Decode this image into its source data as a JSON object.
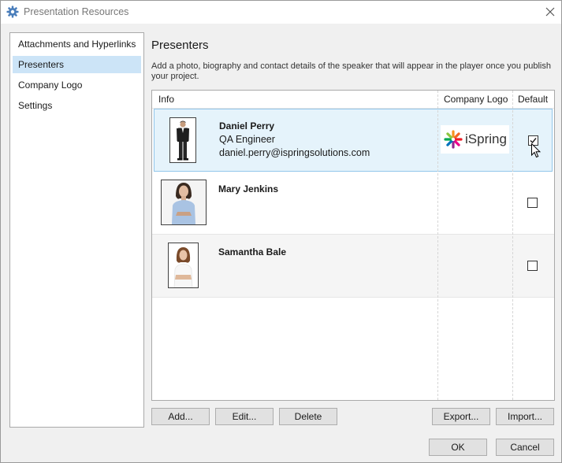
{
  "window": {
    "title": "Presentation Resources",
    "title_icon": "gear-icon",
    "close_icon": "close-icon"
  },
  "sidebar": {
    "items": [
      {
        "label": "Attachments and Hyperlinks",
        "selected": false
      },
      {
        "label": "Presenters",
        "selected": true
      },
      {
        "label": "Company Logo",
        "selected": false
      },
      {
        "label": "Settings",
        "selected": false
      }
    ]
  },
  "main": {
    "title": "Presenters",
    "description": "Add a photo, biography and contact details of the speaker that will appear in the player once you publish your project."
  },
  "table": {
    "columns": [
      "Info",
      "Company Logo",
      "Default"
    ],
    "rows": [
      {
        "name": "Daniel Perry",
        "role": "QA Engineer",
        "email": "daniel.perry@ispringsolutions.com",
        "logo": "iSpring",
        "default": true,
        "selected": true
      },
      {
        "name": "Mary Jenkins",
        "role": "",
        "email": "",
        "logo": "",
        "default": false,
        "selected": false
      },
      {
        "name": "Samantha Bale",
        "role": "",
        "email": "",
        "logo": "",
        "default": false,
        "selected": false
      }
    ]
  },
  "buttons": {
    "add": "Add...",
    "edit": "Edit...",
    "delete": "Delete",
    "export": "Export...",
    "import": "Import..."
  },
  "dialog": {
    "ok": "OK",
    "cancel": "Cancel"
  },
  "colors": {
    "selection": "#cce4f7",
    "row_selected": "#e5f3fb",
    "row_selected_border": "#92c6ea",
    "window_bg": "#f0f0f0"
  }
}
